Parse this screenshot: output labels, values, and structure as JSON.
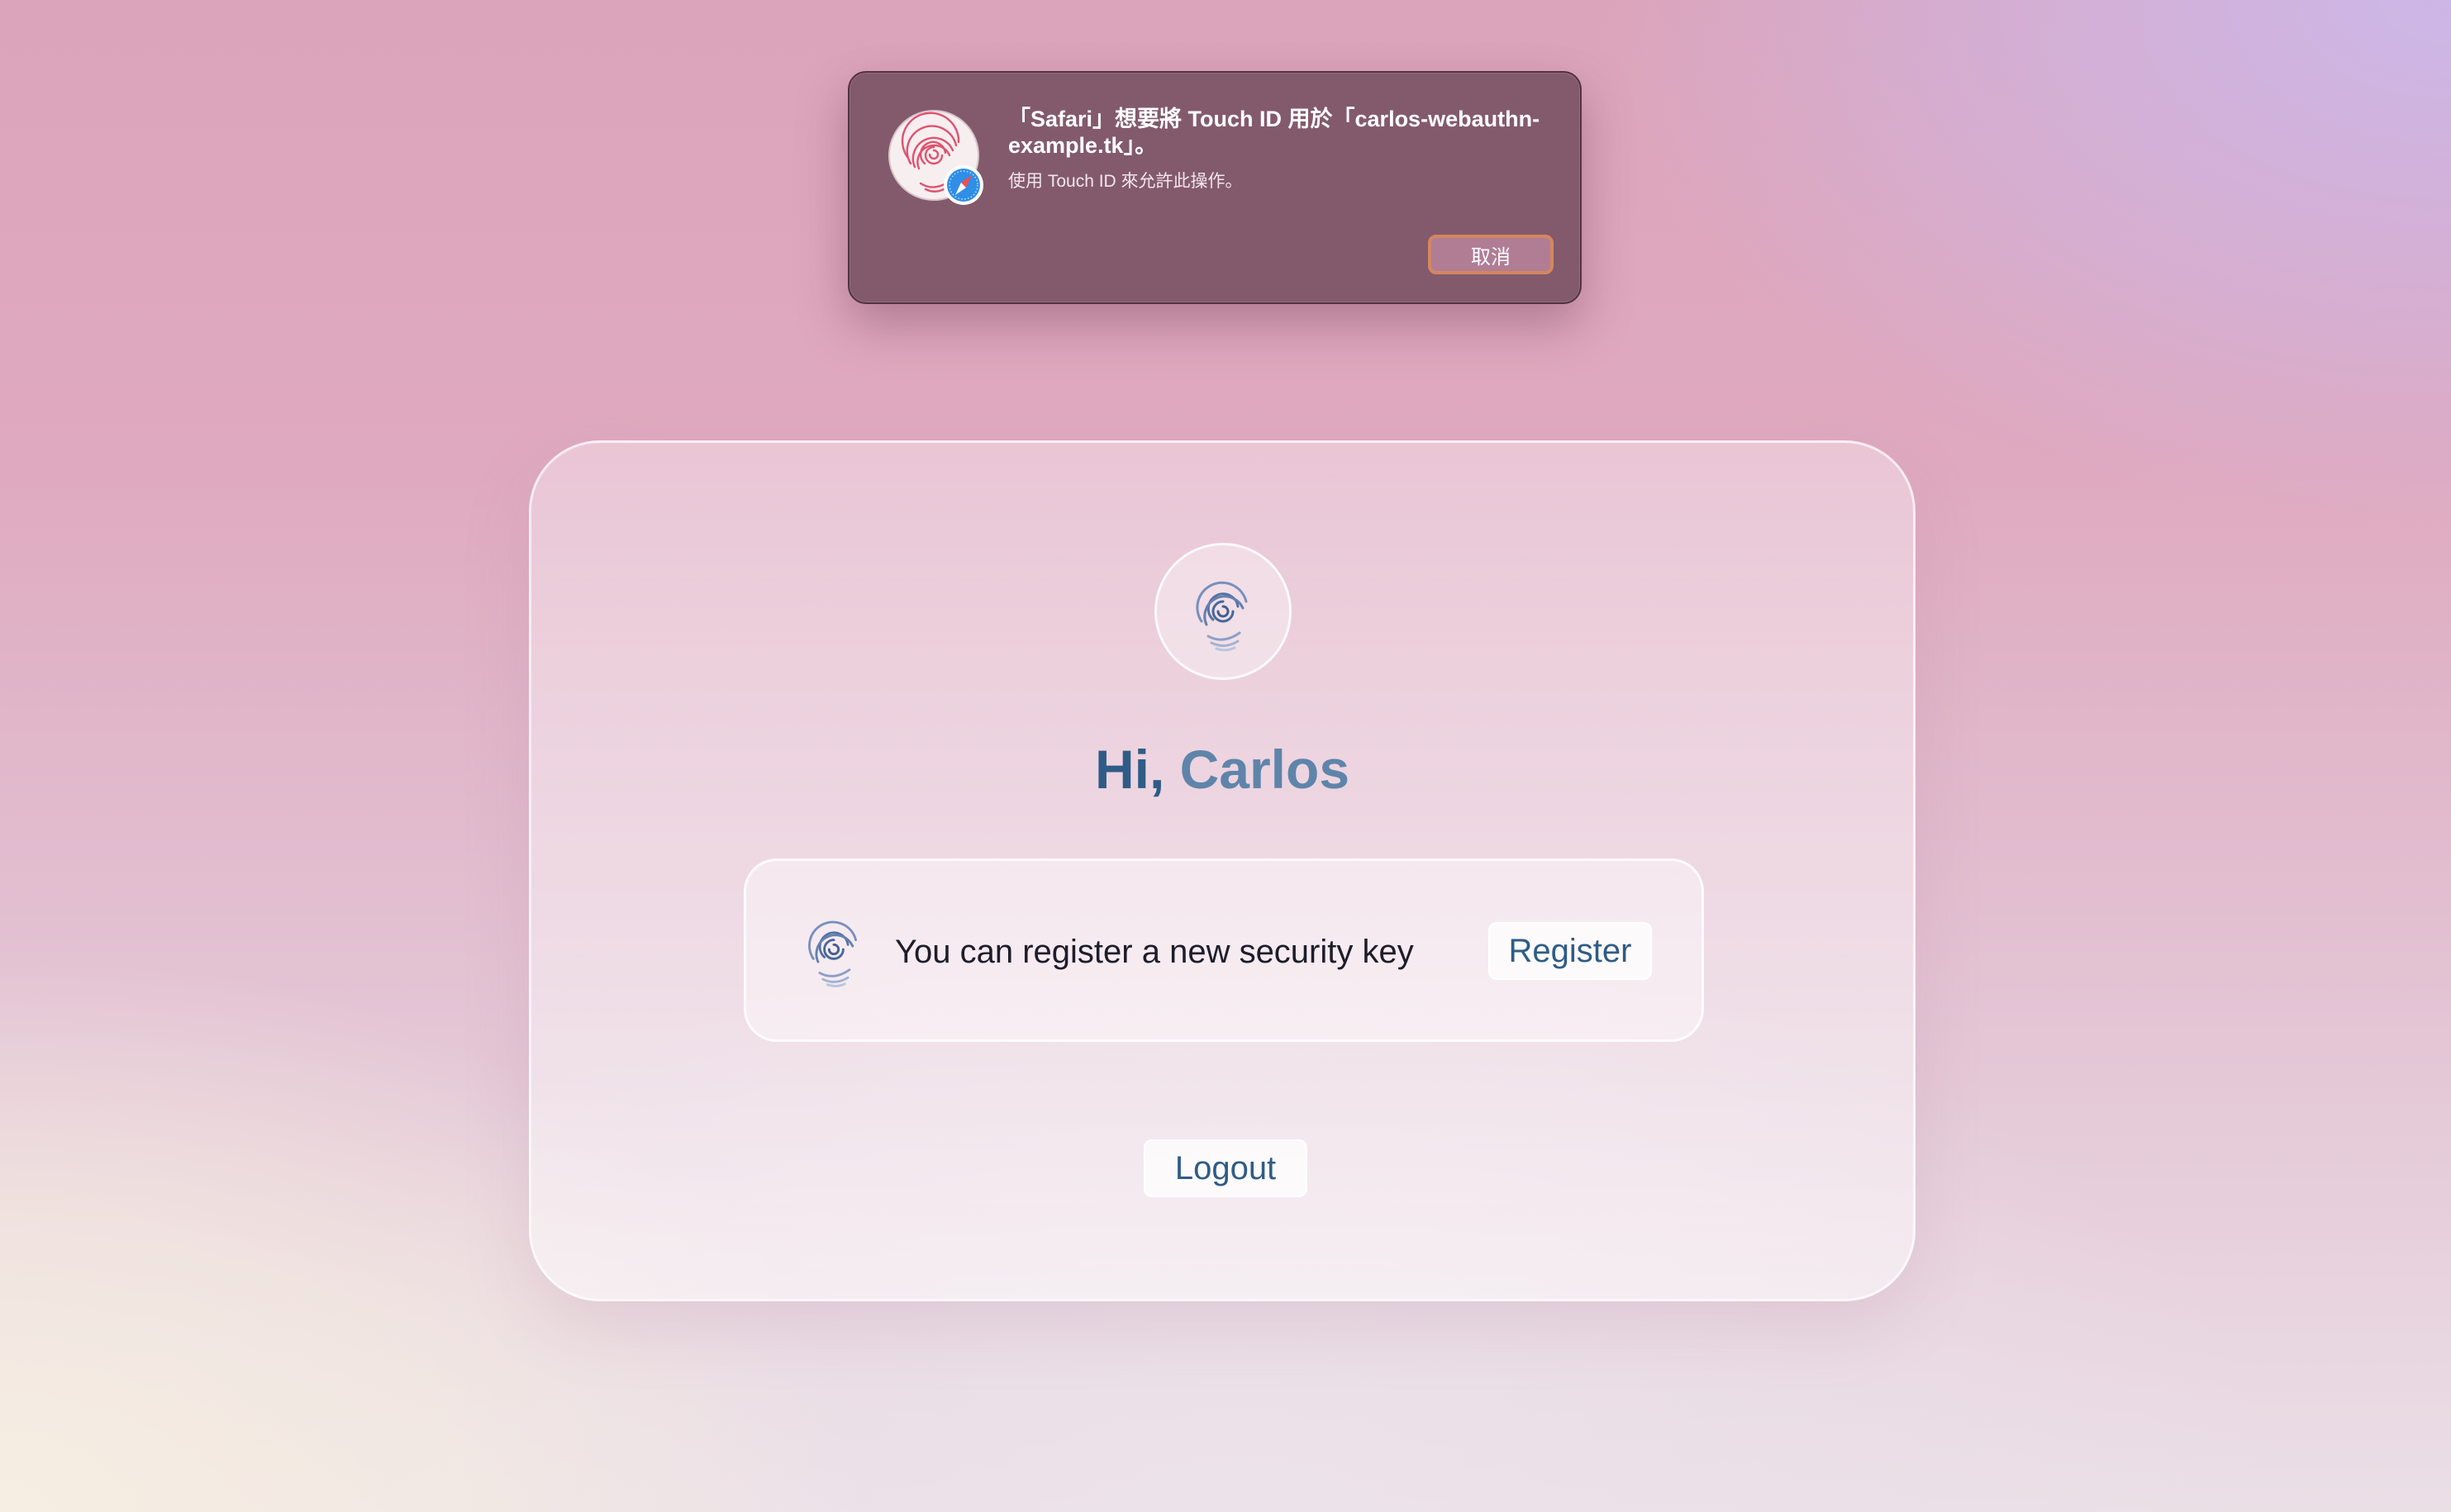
{
  "alert": {
    "title": "「Safari」想要將 Touch ID 用於「carlos-webauthn-example.tk」。",
    "subtitle": "使用 Touch ID 來允許此操作。",
    "cancel_label": "取消",
    "icon": "touch-id-fingerprint-icon",
    "badge_icon": "safari-compass-icon"
  },
  "card": {
    "avatar_icon": "fingerprint-icon",
    "greeting_prefix": "Hi,",
    "greeting_name": "Carlos",
    "key_panel": {
      "icon": "fingerprint-icon",
      "text": "You can register a new security key",
      "register_label": "Register"
    },
    "logout_label": "Logout"
  },
  "colors": {
    "accent": "#2f5c86",
    "accent_light": "#5f84aa",
    "alert_bg": "#835a6c",
    "alert_focus_ring": "#d4875f"
  }
}
